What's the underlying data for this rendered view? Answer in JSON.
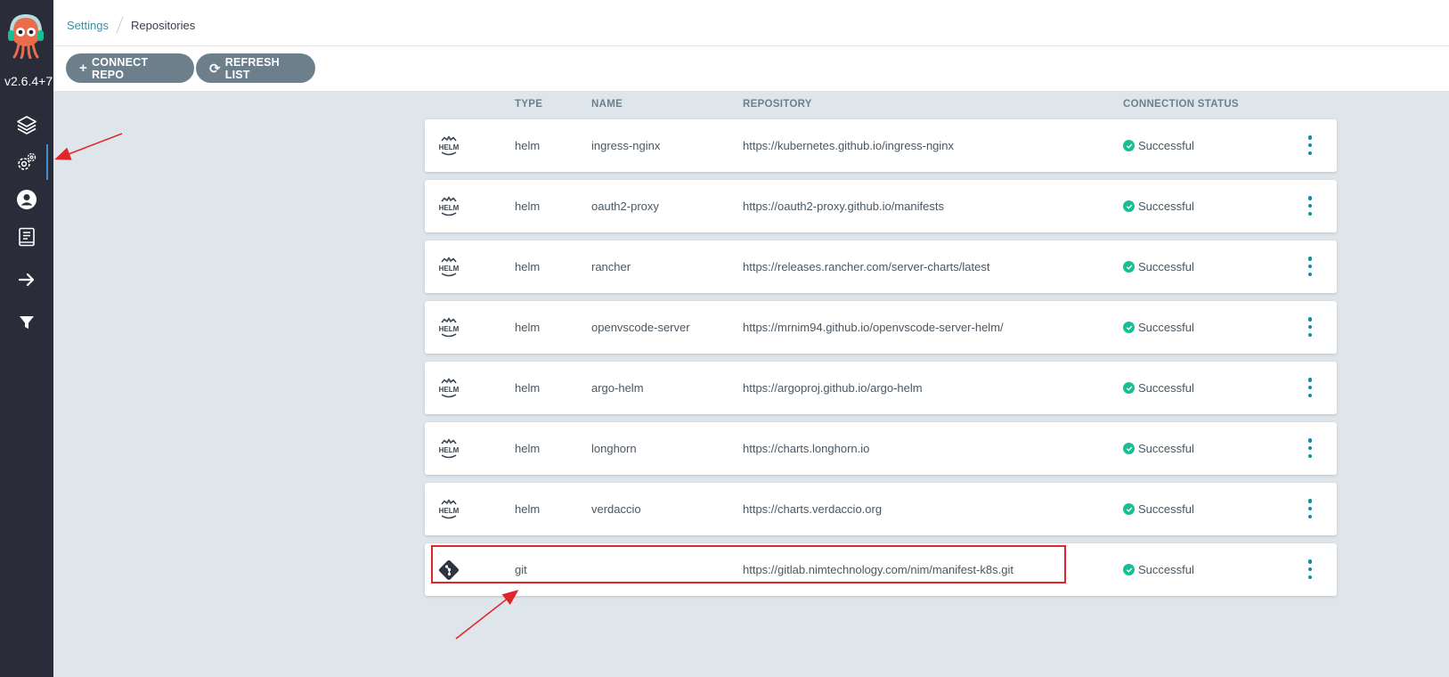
{
  "app": {
    "version": "v2.6.4+7",
    "colors": {
      "sidebar": "#2b2c3a",
      "accent": "#0d8ea6",
      "success": "#18be94",
      "button": "#6d7f8b",
      "annotation": "#e0262b"
    }
  },
  "sidebar": {
    "items": [
      {
        "name": "applications",
        "icon": "layers-icon"
      },
      {
        "name": "settings",
        "icon": "gear-icon",
        "active": true
      },
      {
        "name": "user-info",
        "icon": "user-icon"
      },
      {
        "name": "documentation",
        "icon": "docs-icon"
      },
      {
        "name": "expand",
        "icon": "arrow-right-icon"
      },
      {
        "name": "filter",
        "icon": "filter-icon"
      }
    ]
  },
  "breadcrumb": {
    "parent": "Settings",
    "current": "Repositories"
  },
  "toolbar": {
    "connect_label": "CONNECT REPO",
    "refresh_label": "REFRESH LIST"
  },
  "table": {
    "headers": {
      "type": "TYPE",
      "name": "NAME",
      "repository": "REPOSITORY",
      "status": "CONNECTION STATUS"
    },
    "rows": [
      {
        "icon": "helm-icon",
        "type": "helm",
        "name": "ingress-nginx",
        "repo": "https://kubernetes.github.io/ingress-nginx",
        "status": "Successful"
      },
      {
        "icon": "helm-icon",
        "type": "helm",
        "name": "oauth2-proxy",
        "repo": "https://oauth2-proxy.github.io/manifests",
        "status": "Successful"
      },
      {
        "icon": "helm-icon",
        "type": "helm",
        "name": "rancher",
        "repo": "https://releases.rancher.com/server-charts/latest",
        "status": "Successful"
      },
      {
        "icon": "helm-icon",
        "type": "helm",
        "name": "openvscode-server",
        "repo": "https://mrnim94.github.io/openvscode-server-helm/",
        "status": "Successful"
      },
      {
        "icon": "helm-icon",
        "type": "helm",
        "name": "argo-helm",
        "repo": "https://argoproj.github.io/argo-helm",
        "status": "Successful"
      },
      {
        "icon": "helm-icon",
        "type": "helm",
        "name": "longhorn",
        "repo": "https://charts.longhorn.io",
        "status": "Successful"
      },
      {
        "icon": "helm-icon",
        "type": "helm",
        "name": "verdaccio",
        "repo": "https://charts.verdaccio.org",
        "status": "Successful"
      },
      {
        "icon": "git-icon",
        "type": "git",
        "name": "",
        "repo": "https://gitlab.nimtechnology.com/nim/manifest-k8s.git",
        "status": "Successful"
      }
    ]
  }
}
